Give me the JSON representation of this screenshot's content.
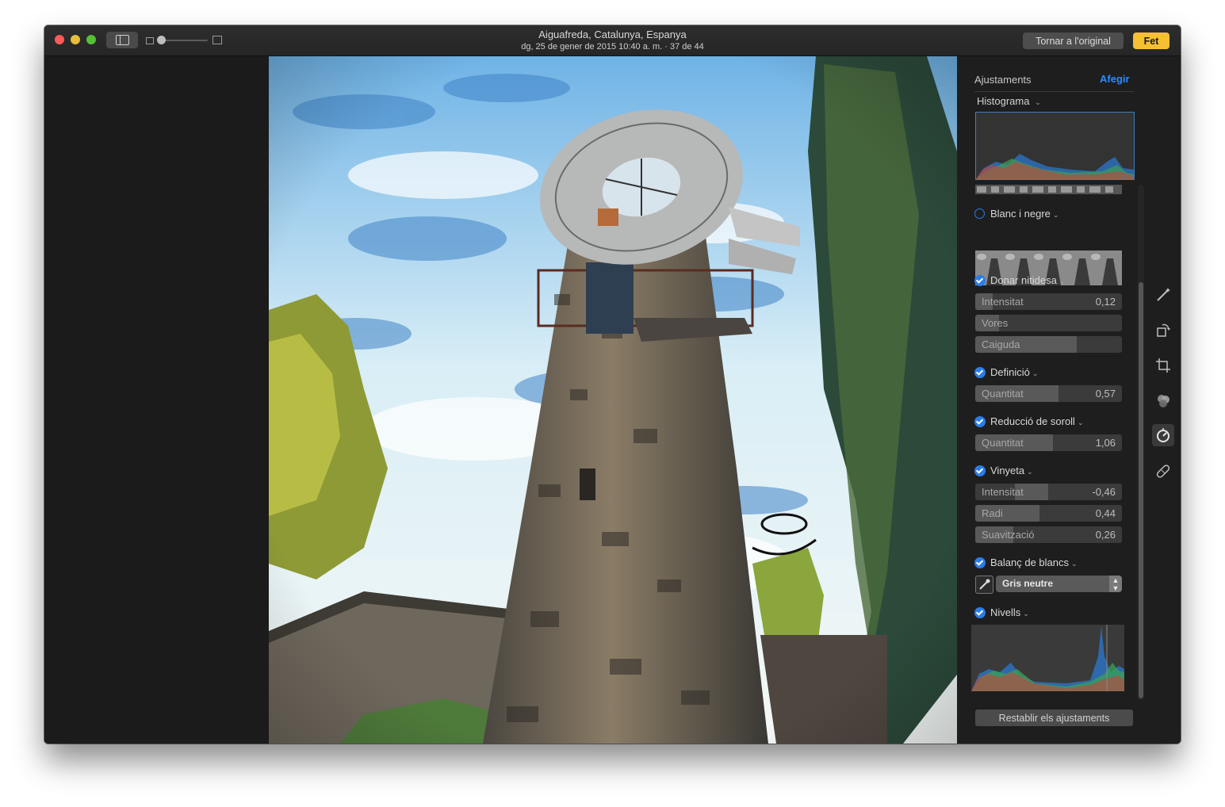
{
  "window": {
    "title": "Aiguafreda, Catalunya, Espanya",
    "subtitle": "dg, 25 de gener de 2015 10:40 a. m.  ·  37 de 44",
    "revert_label": "Tornar a l'original",
    "done_label": "Fet"
  },
  "colors": {
    "accent": "#2b7de9",
    "done": "#f5c133",
    "link": "#2a8cff"
  },
  "panel": {
    "title": "Ajustaments",
    "add_label": "Afegir",
    "histogram_label": "Histograma",
    "sections": {
      "bw": {
        "title": "Blanc i negre",
        "enabled": false
      },
      "sharpen": {
        "title": "Donar nitidesa",
        "enabled": true,
        "sliders": [
          {
            "label": "Intensitat",
            "value": "0,12",
            "level": 0.12
          },
          {
            "label": "Vores",
            "value": "",
            "level": 0.16
          },
          {
            "label": "Caiguda",
            "value": "",
            "level": 0.69
          }
        ]
      },
      "definition": {
        "title": "Definició",
        "enabled": true,
        "sliders": [
          {
            "label": "Quantitat",
            "value": "0,57",
            "level": 0.57
          }
        ]
      },
      "noise": {
        "title": "Reducció de soroll",
        "enabled": true,
        "sliders": [
          {
            "label": "Quantitat",
            "value": "1,06",
            "level": 0.53
          }
        ]
      },
      "vignette": {
        "title": "Vinyeta",
        "enabled": true,
        "sliders": [
          {
            "label": "Intensitat",
            "value": "-0,46",
            "level": -0.46
          },
          {
            "label": "Radi",
            "value": "0,44",
            "level": 0.44
          },
          {
            "label": "Suavització",
            "value": "0,26",
            "level": 0.26
          }
        ]
      },
      "white_balance": {
        "title": "Balanç de blancs",
        "enabled": true,
        "mode": "Gris neutre"
      },
      "levels": {
        "title": "Nivells",
        "enabled": true
      }
    },
    "reset_label": "Restablir els ajustaments"
  },
  "tools": [
    {
      "name": "enhance-icon",
      "active": false
    },
    {
      "name": "rotate-icon",
      "active": false
    },
    {
      "name": "crop-icon",
      "active": false
    },
    {
      "name": "filters-icon",
      "active": false
    },
    {
      "name": "adjust-icon",
      "active": true
    },
    {
      "name": "retouch-icon",
      "active": false
    }
  ]
}
